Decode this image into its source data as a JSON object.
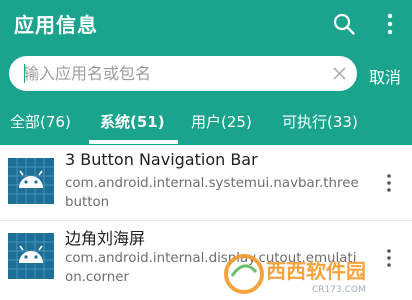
{
  "header": {
    "title": "应用信息",
    "search_icon": "search-icon",
    "more_icon": "more-vertical-icon"
  },
  "search": {
    "placeholder": "输入应用名或包名",
    "value": "",
    "clear_icon": "clear-icon",
    "cancel_label": "取消"
  },
  "tabs": [
    {
      "label": "全部(76)",
      "active": false
    },
    {
      "label": "系统(51)",
      "active": true
    },
    {
      "label": "用户(25)",
      "active": false
    },
    {
      "label": "可执行(33)",
      "active": false
    }
  ],
  "apps": [
    {
      "name": "3 Button Navigation Bar",
      "package": "com.android.internal.systemui.navbar.threebutton",
      "icon": "android-icon"
    },
    {
      "name": "边角刘海屏",
      "package": "com.android.internal.display.cutout.emulation.corner",
      "icon": "android-icon"
    }
  ],
  "watermark": {
    "text": "西西软件园",
    "subtext": "CR173.COM"
  },
  "colors": {
    "primary": "#1aa38d",
    "icon_bg": "#1e6f97",
    "text_primary": "#212121",
    "text_secondary": "#6e6e6e"
  }
}
